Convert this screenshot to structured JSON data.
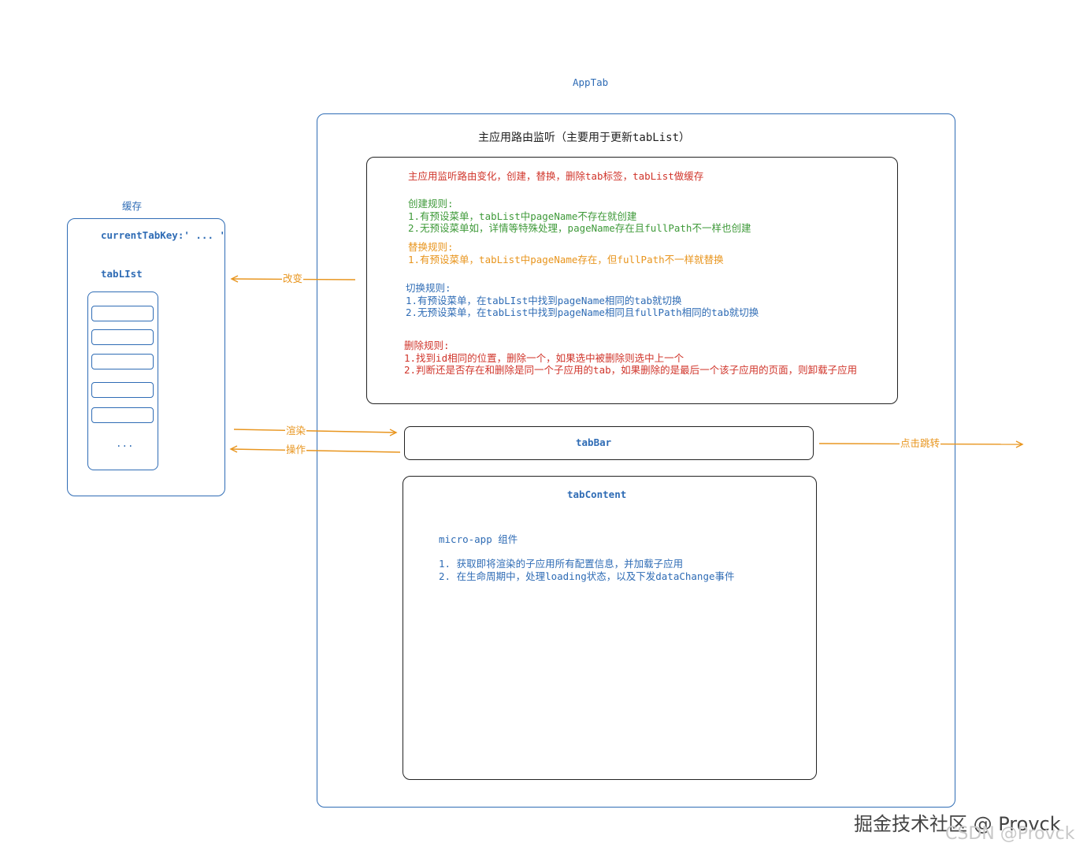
{
  "title": "AppTab",
  "cache": {
    "label": "缓存",
    "current_tab_key": "currentTabKey:' ... '",
    "tab_list_label": "tabLIst",
    "ellipsis": "..."
  },
  "main_listener": {
    "title": "主应用路由监听（主要用于更新tabList）",
    "summary": "主应用监听路由变化，创建，替换，删除tab标签，tabList做缓存",
    "create": {
      "heading": "创建规则:",
      "rules": [
        "1.有预设菜单，tabList中pageName不存在就创建",
        "2.无预设菜单如，详情等特殊处理，pageName存在且fullPath不一样也创建"
      ]
    },
    "replace": {
      "heading": "替换规则:",
      "rules": [
        "1.有预设菜单，tabList中pageName存在，但fullPath不一样就替换"
      ]
    },
    "switch": {
      "heading": "切换规则:",
      "rules": [
        "1.有预设菜单，在tabLIst中找到pageName相同的tab就切换",
        "2.无预设菜单，在tabList中找到pageName相同且fullPath相同的tab就切换"
      ]
    },
    "delete": {
      "heading": "删除规则:",
      "rules": [
        "1.找到id相同的位置，删除一个，如果选中被删除则选中上一个",
        "2.判断还是否存在和删除是同一个子应用的tab，如果删除的是最后一个该子应用的页面，则卸载子应用"
      ]
    }
  },
  "tab_bar": {
    "label": "tabBar"
  },
  "tab_content": {
    "label": "tabContent",
    "component": "micro-app 组件",
    "items": [
      "1. 获取即将渲染的子应用所有配置信息，并加载子应用",
      "2. 在生命周期中，处理loading状态，以及下发dataChange事件"
    ]
  },
  "edges": {
    "change": "改变",
    "render": "渲染",
    "operate": "操作",
    "click_jump": "点击跳转"
  },
  "watermark": {
    "juejin": "掘金技术社区 @ Provck",
    "csdn": "CSDN @Provck"
  },
  "colors": {
    "blue": "#2f6cb5",
    "red": "#d0352b",
    "green": "#3f9a3a",
    "orange": "#e8951e"
  }
}
